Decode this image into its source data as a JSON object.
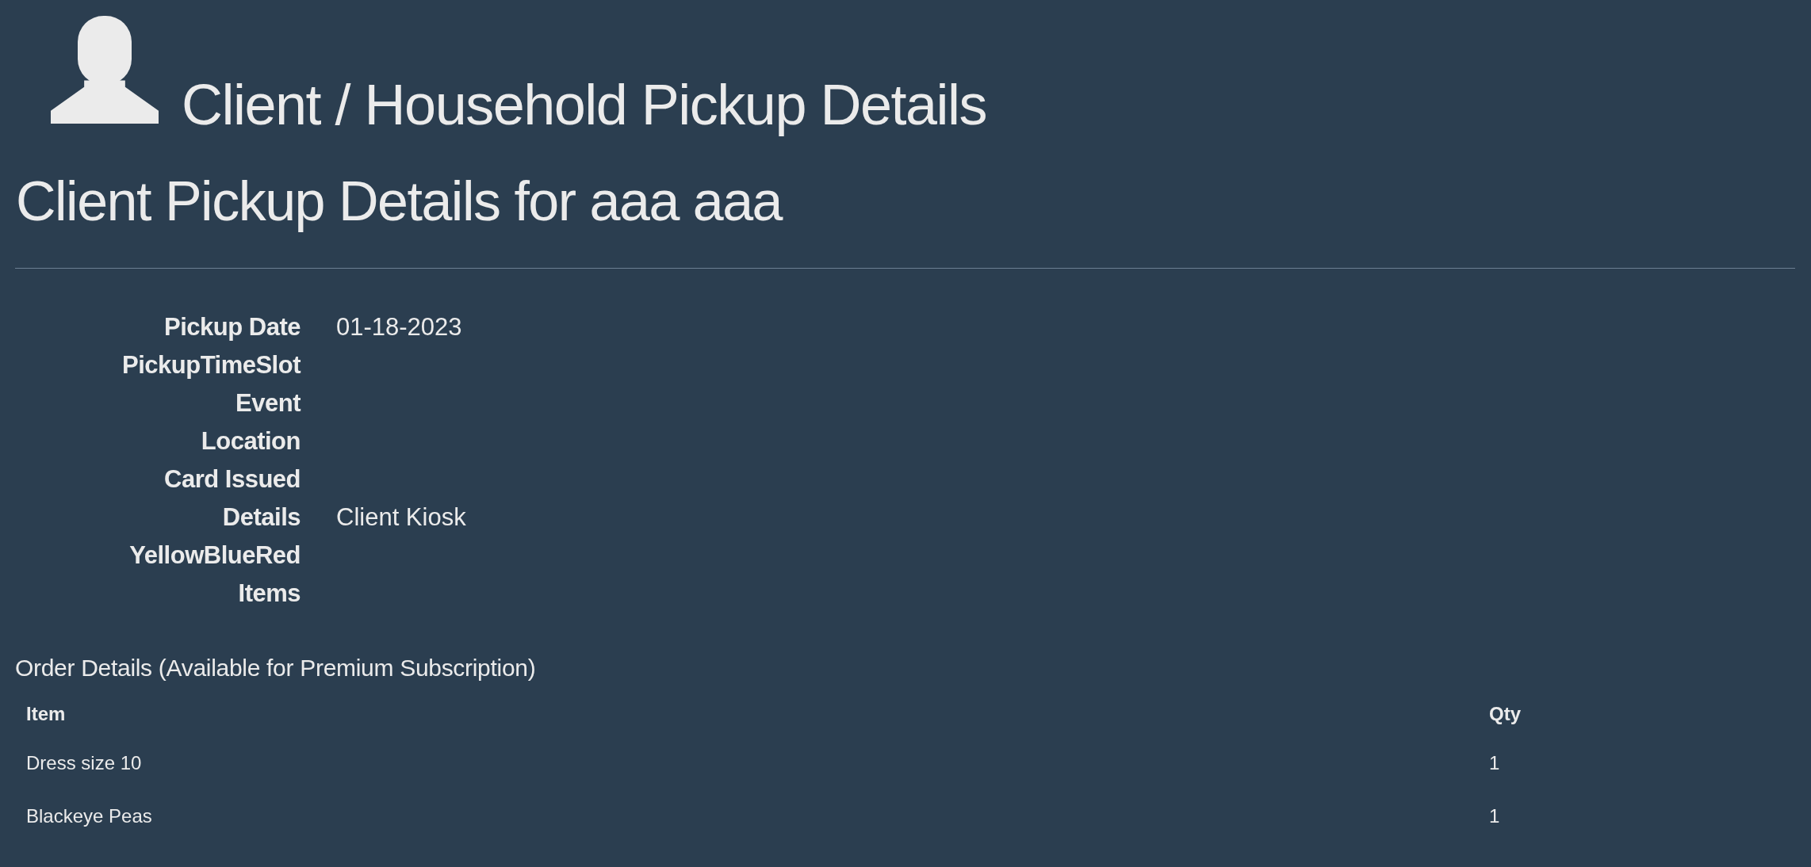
{
  "header": {
    "title": "Client / Household Pickup Details"
  },
  "heading": "Client Pickup Details for aaa aaa",
  "details": [
    {
      "label": "Pickup Date",
      "value": "01-18-2023"
    },
    {
      "label": "PickupTimeSlot"
    },
    {
      "label": "Event"
    },
    {
      "label": "Location"
    },
    {
      "label": "Card Issued"
    },
    {
      "label": "Details",
      "value": "Client Kiosk"
    },
    {
      "label": "YellowBlueRed"
    },
    {
      "label": "Items"
    }
  ],
  "order": {
    "title": "Order Details (Available for Premium Subscription)",
    "columns": [
      "Item",
      "Qty"
    ],
    "rows": [
      [
        "Dress size 10",
        "1"
      ],
      [
        "Blackeye Peas",
        "1"
      ]
    ]
  }
}
